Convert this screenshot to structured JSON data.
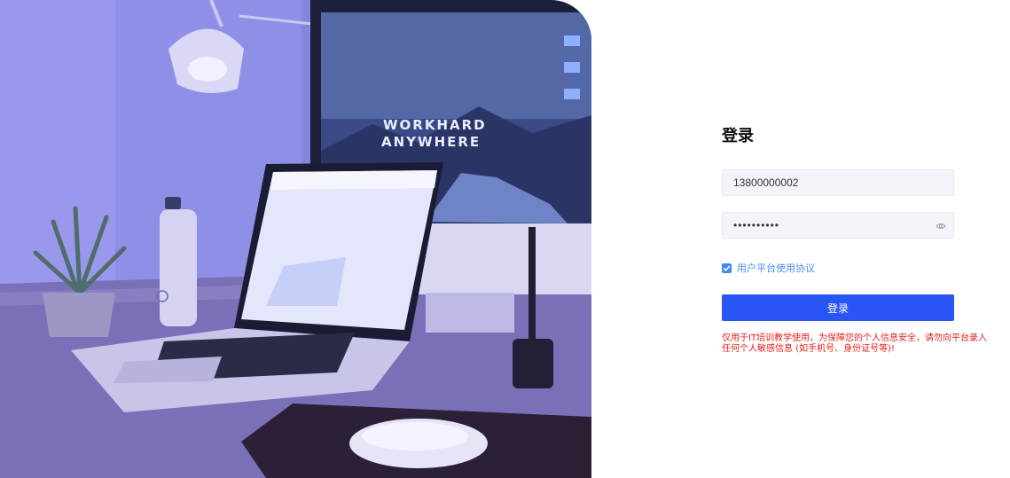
{
  "hero": {
    "monitor_line1": "WORKHARD",
    "monitor_line2": "ANYWHERE"
  },
  "login": {
    "title": "登录",
    "phone_value": "13800000002",
    "password_value": "••••••••••",
    "agreement_checked": true,
    "agreement_label": "用户平台使用协议",
    "submit_label": "登录",
    "notice_line1": "仅用于IT培训教学使用，为保障您的个人信息安全，请勿向平台录入",
    "notice_line2": "任何个人敏感信息 (如手机号、身份证号等)!"
  },
  "colors": {
    "primary": "#2a55f5",
    "link": "#4a8ff0",
    "warning": "#e0201a",
    "hero_tint": "#7f7fe0"
  }
}
